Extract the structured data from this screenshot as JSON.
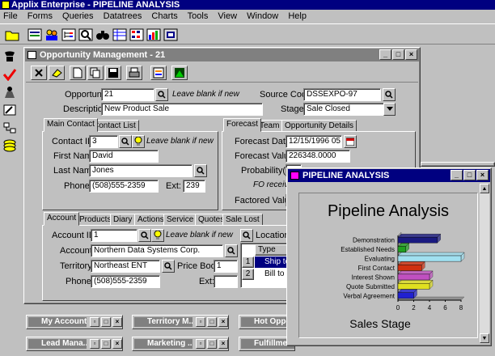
{
  "app": {
    "title": "Applix Enterprise - PIPELINE ANALYSIS"
  },
  "menu": [
    "File",
    "Forms",
    "Queries",
    "Datatrees",
    "Charts",
    "Tools",
    "View",
    "Window",
    "Help"
  ],
  "opportunity_window": {
    "title": "Opportunity Management - 21",
    "opportunity_id_label": "Opportunity ID:",
    "opportunity_id": "21",
    "blank_hint": "Leave blank if new",
    "source_code_label": "Source Code:",
    "source_code": "DSSEXPO-97",
    "description_label": "Description:",
    "description": "New Product Sale",
    "stage_label": "Stage:",
    "stage": "Sale Closed",
    "contact_tabs": [
      "Main Contact",
      "Contact List"
    ],
    "contact_id_label": "Contact ID:",
    "contact_id": "3",
    "first_name_label": "First Name:",
    "first_name": "David",
    "last_name_label": "Last Name:",
    "last_name": "Jones",
    "phone_label": "Phone:",
    "phone": "(508)555-2359",
    "ext_label": "Ext:",
    "ext": "239",
    "forecast_tabs": [
      "Forecast",
      "Team",
      "Opportunity Details"
    ],
    "forecast_date_label": "Forecast Date:",
    "forecast_date": "12/15/1996 05:3",
    "forecast_value_label": "Forecast Value:",
    "forecast_value": "226348.0000",
    "probability_label": "Probability(%):",
    "fo_received": "FO received",
    "factored_value_label": "Factored Value:",
    "account_tabs": [
      "Account",
      "Products",
      "Diary",
      "Actions",
      "Service",
      "Quotes",
      "Sale Lost"
    ],
    "account_id_label": "Account ID:",
    "account_id": "1",
    "account_label": "Account:",
    "account": "Northern Data Systems Corp.",
    "territory_label": "Territory:",
    "territory": "Northeast ENT",
    "price_book_label": "Price Book:",
    "price_book": "1",
    "account_phone_label": "Phone:",
    "account_phone": "(508)555-2359",
    "account_ext_label": "Ext:",
    "locations_label": "Locations:",
    "loc_header": "Type",
    "loc_rows": [
      {
        "n": "1",
        "type": "Ship to"
      },
      {
        "n": "2",
        "type": "Bill to"
      }
    ]
  },
  "pipeline_window": {
    "title": "PIPELINE ANALYSIS"
  },
  "minimized": [
    "My Accounts",
    "Territory M...",
    "Hot Oppo...",
    "Lead Mana...",
    "Marketing ...",
    "Fulfillme..."
  ],
  "colors": {
    "title_active": "#000080",
    "title_inactive": "#808080",
    "chart_bg": "#c0c0c0"
  },
  "chart_data": {
    "type": "bar",
    "orientation": "horizontal",
    "title": "Pipeline Analysis",
    "xlabel": "",
    "ylabel": "Sales Stage",
    "categories": [
      "Demonstration",
      "Established Needs",
      "Evaluating",
      "First Contact",
      "Interest Shown",
      "Quote Submitted",
      "Verbal Agreement"
    ],
    "values": [
      5,
      1,
      8,
      3,
      4,
      4,
      2
    ],
    "bar_colors": [
      "#1a1a80",
      "#20a020",
      "#a0e0f0",
      "#d03010",
      "#c050c0",
      "#e0e020",
      "#2020d0"
    ],
    "xlim": [
      0,
      8
    ],
    "xticks": [
      "0",
      "2",
      "4",
      "6",
      "8"
    ],
    "grid": false,
    "legend": "none"
  }
}
